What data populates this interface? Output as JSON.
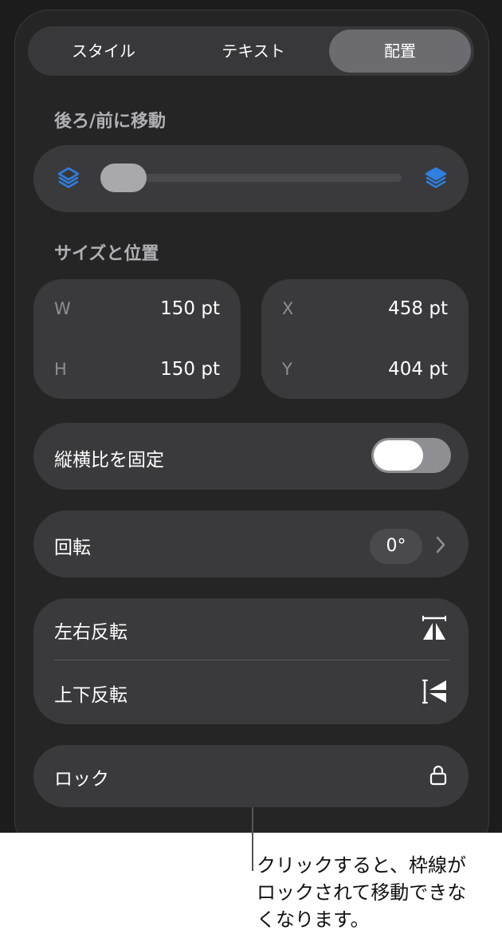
{
  "tabs": [
    {
      "label": "スタイル",
      "active": false
    },
    {
      "label": "テキスト",
      "active": false
    },
    {
      "label": "配置",
      "active": true
    }
  ],
  "arrange": {
    "title": "後ろ/前に移動",
    "back_icon": "layers-back-icon",
    "front_icon": "layers-front-icon",
    "slider_position": 0.0
  },
  "size_position": {
    "title": "サイズと位置",
    "w_label": "W",
    "w_value": "150 pt",
    "h_label": "H",
    "h_value": "150 pt",
    "x_label": "X",
    "x_value": "458 pt",
    "y_label": "Y",
    "y_value": "404 pt"
  },
  "aspect": {
    "label": "縦横比を固定",
    "toggle_on": false
  },
  "rotate": {
    "label": "回転",
    "value": "0°"
  },
  "flip": {
    "horizontal_label": "左右反転",
    "vertical_label": "上下反転"
  },
  "lock": {
    "label": "ロック",
    "icon": "lock-icon"
  },
  "callout": {
    "lines": [
      "クリックすると、枠線が",
      "ロックされて移動できな",
      "くなります。"
    ]
  },
  "colors": {
    "background": "#1c1c1d",
    "panel": "#252526",
    "card": "#3a3a3c",
    "accent_blue": "#2f7fde",
    "active_tab": "#6c6c70"
  }
}
